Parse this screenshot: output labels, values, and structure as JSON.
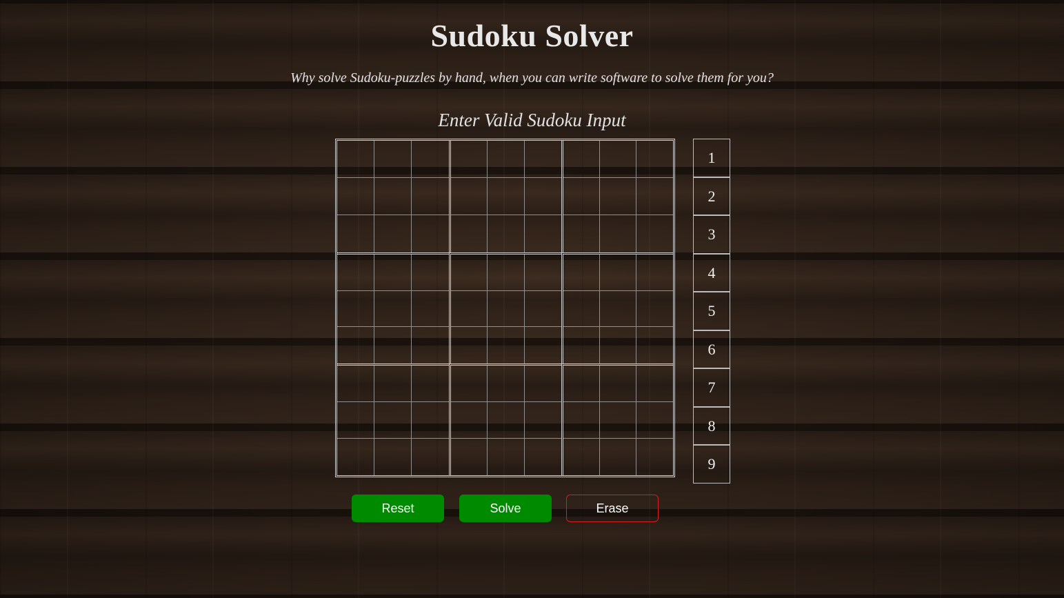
{
  "page": {
    "title": "Sudoku Solver",
    "subtitle": "Why solve Sudoku-puzzles by hand, when you can write software to solve them for you?",
    "grid_heading": "Enter Valid Sudoku Input"
  },
  "board": {
    "size": 9,
    "cells": [
      [
        "",
        "",
        "",
        "",
        "",
        "",
        "",
        "",
        ""
      ],
      [
        "",
        "",
        "",
        "",
        "",
        "",
        "",
        "",
        ""
      ],
      [
        "",
        "",
        "",
        "",
        "",
        "",
        "",
        "",
        ""
      ],
      [
        "",
        "",
        "",
        "",
        "",
        "",
        "",
        "",
        ""
      ],
      [
        "",
        "",
        "",
        "",
        "",
        "",
        "",
        "",
        ""
      ],
      [
        "",
        "",
        "",
        "",
        "",
        "",
        "",
        "",
        ""
      ],
      [
        "",
        "",
        "",
        "",
        "",
        "",
        "",
        "",
        ""
      ],
      [
        "",
        "",
        "",
        "",
        "",
        "",
        "",
        "",
        ""
      ],
      [
        "",
        "",
        "",
        "",
        "",
        "",
        "",
        "",
        ""
      ]
    ]
  },
  "numpad": {
    "keys": [
      "1",
      "2",
      "3",
      "4",
      "5",
      "6",
      "7",
      "8",
      "9"
    ]
  },
  "actions": {
    "reset_label": "Reset",
    "solve_label": "Solve",
    "erase_label": "Erase"
  },
  "colors": {
    "primary_button": "#008a00",
    "danger_outline": "#d81e1e",
    "text": "#e4e4e4"
  }
}
